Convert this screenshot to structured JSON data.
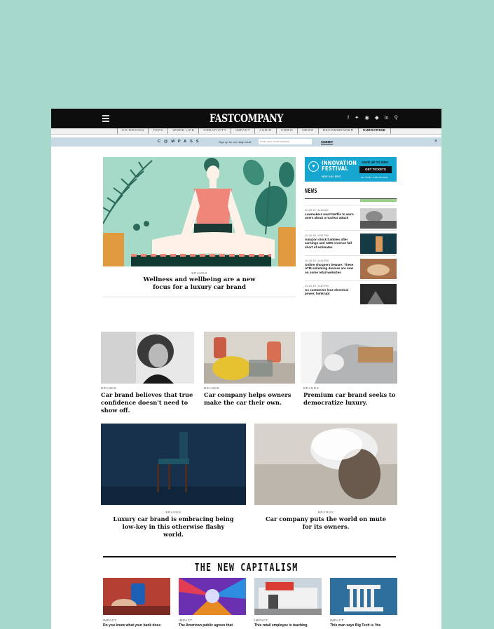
{
  "header": {
    "logo": "FASTCOMPANY",
    "nav": [
      "CO.DESIGN",
      "TECH",
      "WORK LIFE",
      "CREATIVITY",
      "IMPACT",
      "AUDIO",
      "VIDEO",
      "NEWS",
      "RECOMMENDER",
      "SUBSCRIBE"
    ],
    "social_icons": [
      "facebook-icon",
      "twitter-icon",
      "instagram-icon",
      "pocket-icon",
      "linkedin-icon",
      "search-icon"
    ]
  },
  "compass": {
    "brand": "C@MPASS",
    "signup": "Sign up for our daily email",
    "email_placeholder": "Enter your email address",
    "submit": "SUBMIT",
    "close": "×"
  },
  "hero": {
    "kicker": "BRANDS",
    "title": "Wellness and wellbeing are a new focus for a luxury car brand"
  },
  "ad": {
    "line1": "INNOVATION",
    "line2": "FESTIVAL",
    "dates": "NOV 4-8 / NYC",
    "save": "SAVE UP TO $300",
    "cta": "GET TICKETS",
    "note": "ALL TICKET TYPES ON SALE"
  },
  "news": {
    "title": "NEWS",
    "items": [
      {
        "time": "10.25.19 | 8:38 AM",
        "headline": "Lawmakers want Netflix to warn users about a nuclear attack"
      },
      {
        "time": "10.24.19 | 4:51 PM",
        "headline": "Amazon stock tumbles after earnings and AWS revenue fall short of estimates"
      },
      {
        "time": "10.24.19 | 4:16 PM",
        "headline": "Online shoppers beware: These ATM skimming devices are now on some retail websites"
      },
      {
        "time": "10.24.19 | 3:30 PM",
        "headline": "As customers lose electrical power, bankrupt"
      }
    ]
  },
  "cards": [
    {
      "kicker": "BRANDS",
      "title": "Car brand believes that true confidence doesn't need to show off."
    },
    {
      "kicker": "BRANDS",
      "title": "Car company helps owners make the car their own."
    },
    {
      "kicker": "BRANDS",
      "title": "Premium car brand seeks to democratize luxury."
    },
    {
      "kicker": "BRANDS",
      "title": "Luxury car brand is embracing being low-key in this otherwise flashy world."
    },
    {
      "kicker": "BRANDS",
      "title": "Car company puts the world on mute for its owners."
    }
  ],
  "section": {
    "title": "THE NEW CAPITALISM",
    "items": [
      {
        "kicker": "IMPACT",
        "title": "Do you know what your bank does"
      },
      {
        "kicker": "IMPACT",
        "title": "The American public agrees that"
      },
      {
        "kicker": "IMPACT",
        "title": "This retail employee is teaching"
      },
      {
        "kicker": "IMPACT",
        "title": "This man says Big Tech is 'the"
      }
    ]
  }
}
